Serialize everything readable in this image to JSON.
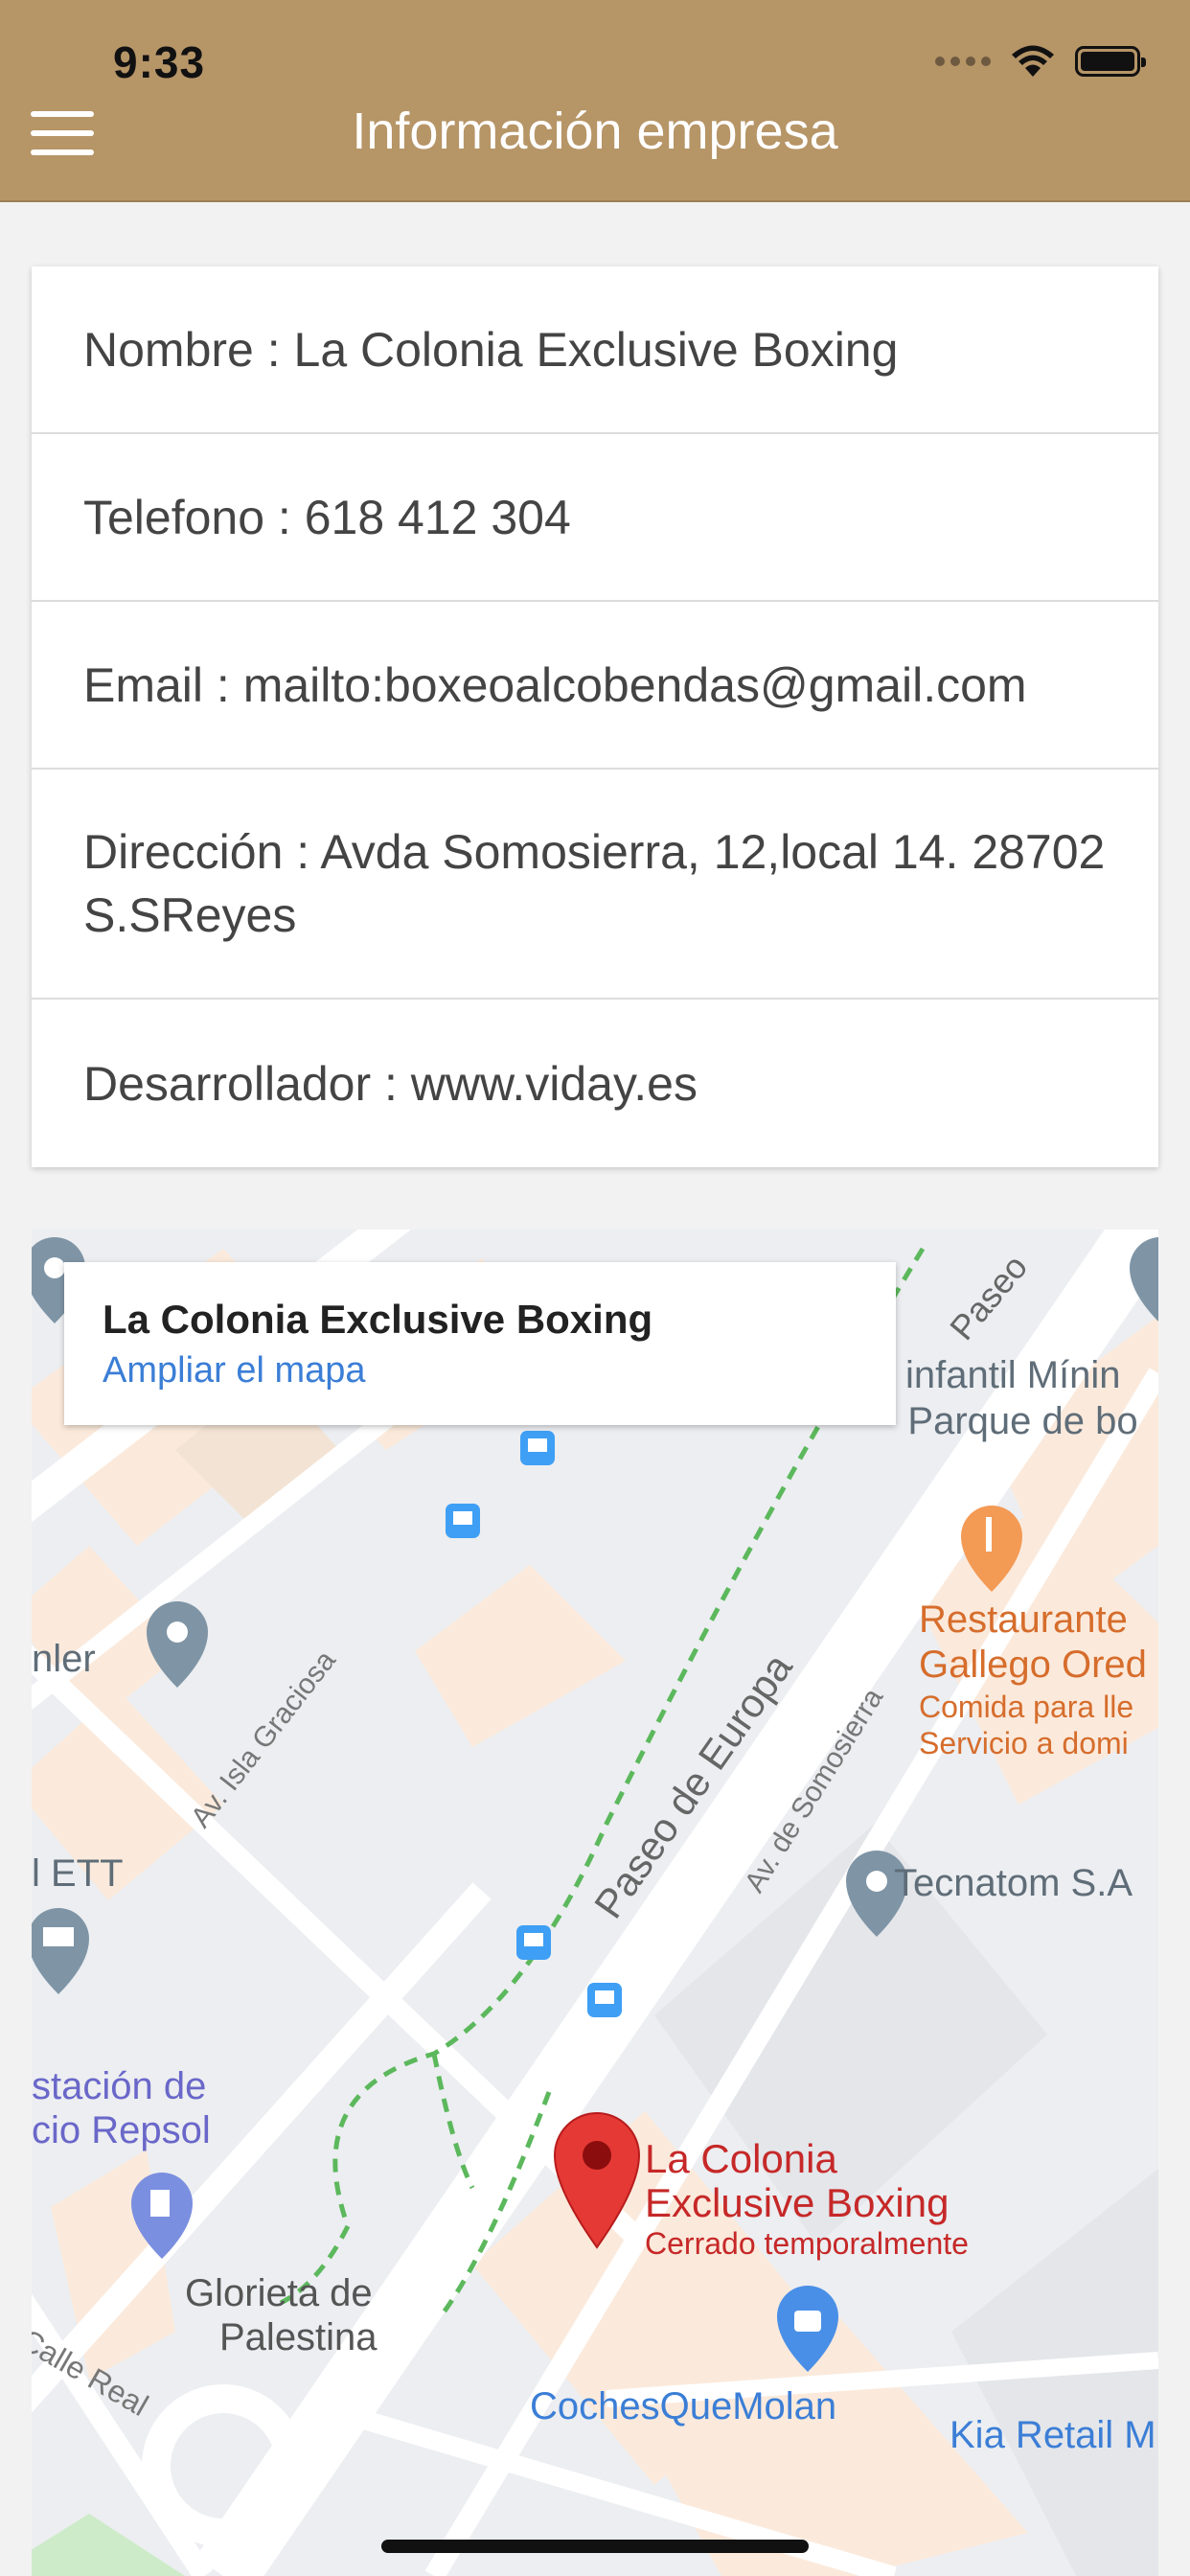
{
  "status_bar": {
    "time": "9:33"
  },
  "header": {
    "title": "Información empresa"
  },
  "info": {
    "rows": [
      {
        "text": "Nombre : La Colonia Exclusive Boxing"
      },
      {
        "text": "Telefono : 618 412 304"
      },
      {
        "text": "Email : mailto:boxeoalcobendas@gmail.com"
      },
      {
        "text": "Dirección : Avda Somosierra, 12,local 14. 28702 S.SReyes"
      },
      {
        "text": "Desarrollador : www.viday.es"
      }
    ]
  },
  "map": {
    "popup_title": "La Colonia Exclusive Boxing",
    "popup_link": "Ampliar el mapa",
    "labels": {
      "paseo_top": "Paseo",
      "infantil": "infantil Mínin",
      "parque": "- Parque de bo",
      "restaurante": "Restaurante",
      "gallego": "Gallego Ored",
      "comida": "Comida para lle",
      "servicio": "Servicio a domi",
      "nler": "nler",
      "isla_graciosa": "Av. Isla Graciosa",
      "paseo_europa": "Paseo de Europa",
      "av_somosierra": "Av. de Somosierra",
      "ett": "l ETT",
      "tecnatom": "Tecnatom S.A",
      "estacion1": "stación de",
      "estacion2": "cio Repsol",
      "pin_name1": "La Colonia",
      "pin_name2": "Exclusive Boxing",
      "pin_status": "Cerrado temporalmente",
      "glorieta1": "Glorieta de",
      "glorieta2": "Palestina",
      "calle_real": "Calle Real",
      "coches": "CochesQueMolan",
      "kia": "Kia Retail M"
    },
    "colors": {
      "road": "#ffffff",
      "block": "#fbeadc",
      "ground": "#eceef1",
      "park": "#cdebc8",
      "poi_gray": "#7f95a6",
      "poi_orange": "#f39a55",
      "poi_blue": "#4a8fe7",
      "pin_red": "#e53935",
      "trail": "#5cb85c"
    }
  }
}
